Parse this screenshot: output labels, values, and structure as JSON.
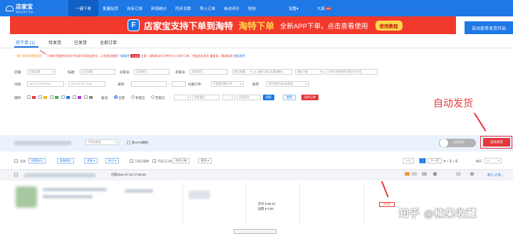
{
  "app": {
    "name": "店家宝",
    "subtitle": "网店业务工作台"
  },
  "nav": {
    "tabs": [
      "一键下单",
      "批量验货",
      "自有订单",
      "利润统计",
      "同步关联",
      "导入订单",
      "自动评价",
      "短信"
    ],
    "system_menu": "设置▾",
    "user": "大辰",
    "badge": "new"
  },
  "banner": {
    "icon_letter": "F",
    "text_white": "店家宝支持下单到淘特",
    "text_yellow": "淘特下单",
    "text_sub": "全新APP下单，点击查看使用",
    "button": "使用教程",
    "side_button": "自动查单发货开启"
  },
  "order_tabs": [
    "待下单 (1)",
    "待发货",
    "已发货",
    "全部订单"
  ],
  "notice": {
    "orange": "一键下单采购数据同步，",
    "red": "下单前不要使用同台手机改不同淘宝账号，以免造成被限",
    "blue": "下载插件",
    "tag": "1.4.8",
    "red2": "注意：采购和自行开单不计入同步订单，不能会员成功 重复条，重调选项",
    "blue2": "使用说明"
  },
  "filters": {
    "store_label": "店铺:",
    "store_value": "全部店铺",
    "title_label": "标题:",
    "title_placeholder": "宝贝标题",
    "buyer_label": "买家号:",
    "buyer_placeholder": "买家账号",
    "seller_label": "卖家号:",
    "seller_placeholder": "卖家账号",
    "product_type": "商品标题",
    "product_placeholder": "请输入商品标题/编码",
    "flag_type": "旗帜计量",
    "flag_placeholder": "订单号/快递单号/地址/手机号",
    "time_label": "付款:",
    "date_from": "2021-07-07 00:00",
    "date_to": "2021-07-22 23:59",
    "purchase_label": "采购:",
    "amount_label": "问题订单:",
    "amount_value": "不筛选问题订单",
    "sort_label": "排序:",
    "sort_value": "按付款时间从高到低",
    "flag_label": "旗帜:",
    "remark_label": "备注:",
    "remark_options": [
      "全部",
      "有留言",
      "无留言"
    ],
    "seller_memo": "卖家备注",
    "buyer_memo": "买家留言",
    "search": "搜索",
    "reset": "重置",
    "sync": "同步订单"
  },
  "annotation": "自动发货",
  "strip": {
    "select_value": "不筛选套餐",
    "vpn_label": "防VPN限制",
    "toggle_text": "自动发货",
    "auto_button": "自动发货"
  },
  "toolbar": {
    "select_all": "全选",
    "buttons": [
      "批量标记",
      "批量改价",
      "关联 ▾",
      "标记 ▾"
    ],
    "hide_label": "只显示留单",
    "unsync_label": "不显示已合并订单",
    "merge": "合并订单",
    "more": "更多 ▾",
    "pager": "1 / 1",
    "next": "下一页",
    "total_prefix": "共",
    "total_pages": "1",
    "total_text": "页 1 条",
    "per_page": "每页",
    "per_page_value": "10"
  },
  "order": {
    "id": "付款2021-07-22 17:55:35",
    "price1": "实付 ¥ 59.10",
    "price2": "运费 ¥ 0.00",
    "ship_button": "去发货",
    "right_link": "备注 (正常)",
    "right_num": "1"
  },
  "watermark": "知乎 @楠果收藏"
}
